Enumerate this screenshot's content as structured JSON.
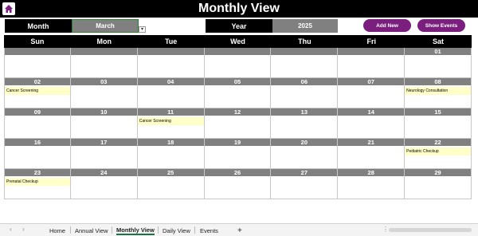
{
  "header": {
    "title": "Monthly View"
  },
  "controls": {
    "month_label": "Month",
    "month_value": "March",
    "year_label": "Year",
    "year_value": "2025",
    "add_new_label": "Add New",
    "show_events_label": "Show Events"
  },
  "days_of_week": [
    "Sun",
    "Mon",
    "Tue",
    "Wed",
    "Thu",
    "Fri",
    "Sat"
  ],
  "weeks": [
    [
      {
        "d": ""
      },
      {
        "d": ""
      },
      {
        "d": ""
      },
      {
        "d": ""
      },
      {
        "d": ""
      },
      {
        "d": ""
      },
      {
        "d": "01"
      }
    ],
    [
      {
        "d": "02",
        "event": "Cancer Screening"
      },
      {
        "d": "03"
      },
      {
        "d": "04"
      },
      {
        "d": "05"
      },
      {
        "d": "06"
      },
      {
        "d": "07"
      },
      {
        "d": "08",
        "event": "Neurology Consultation"
      }
    ],
    [
      {
        "d": "09"
      },
      {
        "d": "10"
      },
      {
        "d": "11",
        "event": "Cancer Screening"
      },
      {
        "d": "12"
      },
      {
        "d": "13"
      },
      {
        "d": "14"
      },
      {
        "d": "15"
      }
    ],
    [
      {
        "d": "16"
      },
      {
        "d": "17"
      },
      {
        "d": "18"
      },
      {
        "d": "19"
      },
      {
        "d": "20"
      },
      {
        "d": "21"
      },
      {
        "d": "22",
        "event": "Pediatric Checkup"
      }
    ],
    [
      {
        "d": "23",
        "event": "Prenatal Checkup"
      },
      {
        "d": "24"
      },
      {
        "d": "25"
      },
      {
        "d": "26"
      },
      {
        "d": "27"
      },
      {
        "d": "28"
      },
      {
        "d": "29"
      }
    ]
  ],
  "sheet_tabs": [
    "Home",
    "Annual View",
    "Monthly View",
    "Daily View",
    "Events"
  ],
  "active_tab": "Monthly View",
  "icons": {
    "home": "home-icon",
    "add_sheet": "+",
    "prev": "‹",
    "next": "›"
  }
}
